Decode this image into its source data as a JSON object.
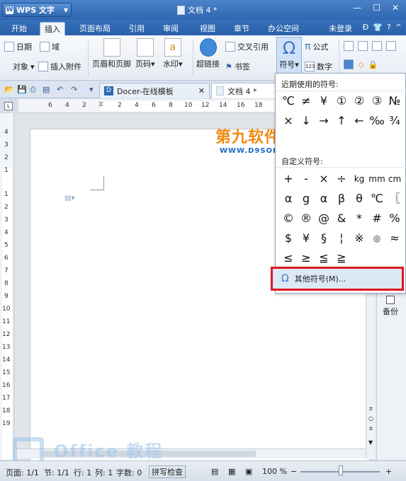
{
  "titlebar": {
    "app_name": "WPS 文字",
    "doc_title": "文档 4 *"
  },
  "tabs": [
    {
      "label": "开始"
    },
    {
      "label": "插入"
    },
    {
      "label": "页面布局"
    },
    {
      "label": "引用"
    },
    {
      "label": "审阅"
    },
    {
      "label": "视图"
    },
    {
      "label": "章节"
    },
    {
      "label": "办公空间"
    }
  ],
  "login_label": "未登录",
  "ribbon": {
    "date": "日期",
    "field": "域",
    "object": "对象",
    "attach": "插入附件",
    "header_footer": "页眉和页脚",
    "page_num": "页码",
    "watermark": "水印",
    "hyperlink": "超链接",
    "crossref": "交叉引用",
    "bookmark": "书签",
    "symbol": "符号",
    "formula": "公式",
    "number": "数字"
  },
  "doc_tabs": [
    {
      "label": "Docer-在线模板"
    },
    {
      "label": "文档 4 *"
    }
  ],
  "hruler_numbers": [
    "6",
    "4",
    "2",
    "2",
    "4",
    "6",
    "8",
    "10",
    "12",
    "14",
    "16",
    "18"
  ],
  "vruler_numbers": [
    "4",
    "3",
    "2",
    "1",
    "1",
    "2",
    "3",
    "4",
    "5",
    "6",
    "7",
    "8",
    "9",
    "10",
    "11",
    "12",
    "13",
    "14",
    "15",
    "16",
    "17",
    "18",
    "19"
  ],
  "dropdown": {
    "recent_title": "近期使用的符号:",
    "recent_row1": [
      "℃",
      "≠",
      "¥",
      "①",
      "②",
      "③",
      "№"
    ],
    "recent_row2": [
      "×",
      "↓",
      "→",
      "↑",
      "←",
      "‰",
      "¾"
    ],
    "custom_title": "自定义符号:",
    "custom_rows": [
      [
        "+",
        "-",
        "×",
        "÷",
        "kg",
        "mm",
        "cm"
      ],
      [
        "α",
        "g",
        "α",
        "β",
        "θ",
        "℃",
        "〖"
      ],
      [
        "©",
        "®",
        "@",
        "&",
        "*",
        "#",
        "%"
      ],
      [
        "$",
        "¥",
        "§",
        "¦",
        "※",
        "◎",
        "≈"
      ],
      [
        "≤",
        "≥",
        "≦",
        "≧"
      ]
    ],
    "more_label": "其他符号(M)..."
  },
  "side": {
    "backup": "备份"
  },
  "status": {
    "page": "页面: 1/1",
    "section": "节: 1/1",
    "row": "行: 1",
    "col": "列: 1",
    "wordcount": "字数: 0",
    "spell": "拼写检查",
    "zoom": "100 %"
  },
  "watermark_text": "Office 教程",
  "brand": {
    "name": "第九软件网",
    "url": "WWW.D9SOFT.COM"
  }
}
